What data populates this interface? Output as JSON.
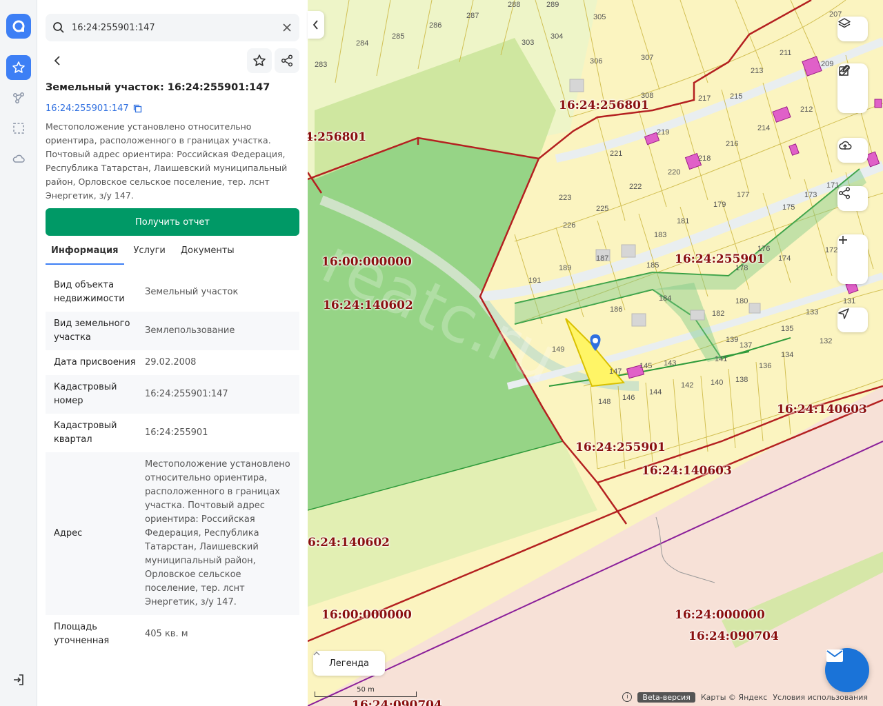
{
  "search": {
    "value": "16:24:255901:147",
    "placeholder": ""
  },
  "object": {
    "title": "Земельный участок: 16:24:255901:147",
    "cadastral_link": "16:24:255901:147",
    "description": "Местоположение установлено относительно ориентира, расположенного в границах участка. Почтовый адрес ориентира: Российская Федерация, Республика Татарстан, Лаишевский муниципальный район, Орловское сельское поселение, тер. лснт Энергетик, з/у 147."
  },
  "actions": {
    "report_label": "Получить отчет"
  },
  "tabs": [
    {
      "label": "Информация",
      "active": true
    },
    {
      "label": "Услуги",
      "active": false
    },
    {
      "label": "Документы",
      "active": false
    }
  ],
  "info_rows": [
    {
      "key": "Вид объекта недвижимости",
      "value": "Земельный участок"
    },
    {
      "key": "Вид земельного участка",
      "value": "Землепользование"
    },
    {
      "key": "Дата присвоения",
      "value": "29.02.2008"
    },
    {
      "key": "Кадастровый номер",
      "value": "16:24:255901:147"
    },
    {
      "key": "Кадастровый квартал",
      "value": "16:24:255901"
    },
    {
      "key": "Адрес",
      "value": "Местоположение установлено относительно ориентира, расположенного в границах участка. Почтовый адрес ориентира: Российская Федерация, Республика Татарстан, Лаишевский муниципальный район, Орловское сельское поселение, тер. лснт Энергетик, з/у 147."
    },
    {
      "key": "Площадь уточненная",
      "value": "405 кв. м"
    }
  ],
  "map": {
    "quarter_labels": [
      "16:24:256801",
      "4:256801",
      "16:00:000000",
      "16:24:140602",
      "16:24:255901",
      "16:24:140603",
      "16:24:255901",
      "16:24:140603",
      "6:24:140602",
      "16:00:000000",
      "16:24:000000",
      "16:24:090704",
      "16:24:090704"
    ],
    "parcel_numbers": [
      "305",
      "303",
      "304",
      "306",
      "307",
      "308",
      "287",
      "286",
      "285",
      "284",
      "283",
      "288",
      "289",
      "211",
      "213",
      "215",
      "217",
      "209",
      "212",
      "214",
      "216",
      "219",
      "218",
      "220",
      "221",
      "222",
      "223",
      "225",
      "226",
      "179",
      "177",
      "175",
      "173",
      "181",
      "183",
      "185",
      "187",
      "189",
      "191",
      "176",
      "174",
      "172",
      "178",
      "180",
      "182",
      "184",
      "186",
      "139",
      "137",
      "136",
      "134",
      "133",
      "135",
      "132",
      "131",
      "141",
      "143",
      "145",
      "147",
      "149",
      "148",
      "146",
      "144",
      "142",
      "140",
      "138",
      "171",
      "207"
    ],
    "watermark": "reatc.ru",
    "legend_label": "Легенда",
    "scale_label": "50 m",
    "beta_label": "Beta-версия",
    "attribution": "Карты © Яндекс",
    "terms": "Условия использования"
  }
}
